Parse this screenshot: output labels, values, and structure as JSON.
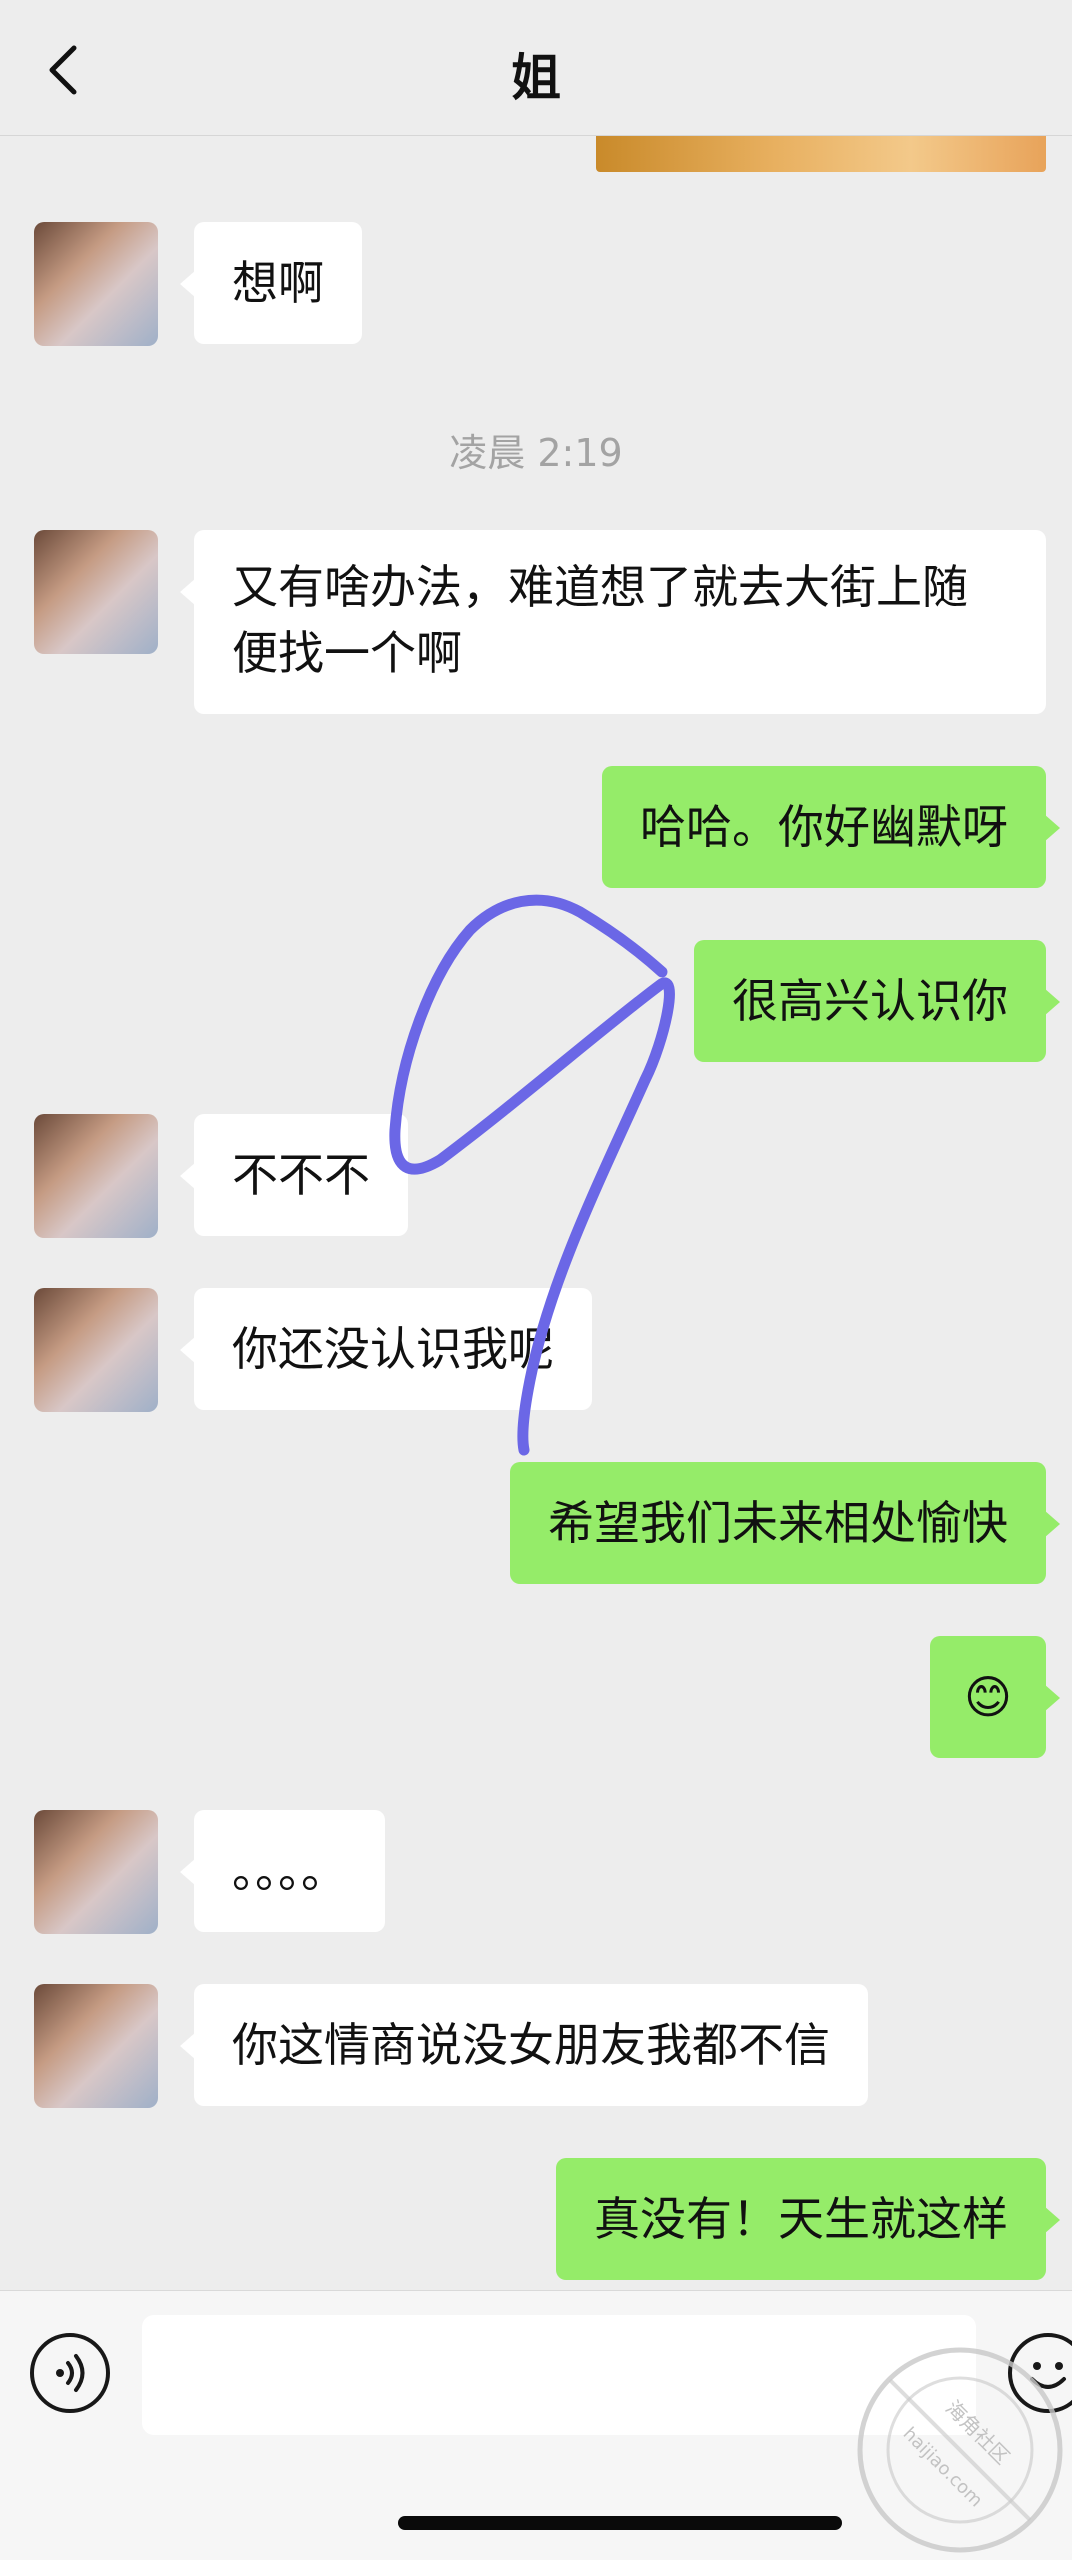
{
  "header": {
    "title": "姐"
  },
  "timestamp": "凌晨 2:19",
  "messages": [
    {
      "side": "left",
      "text": "想啊"
    },
    {
      "side": "left",
      "text": "又有啥办法，难道想了就去大街上随便找一个啊"
    },
    {
      "side": "right",
      "text": "哈哈。你好幽默呀"
    },
    {
      "side": "right",
      "text": "很高兴认识你"
    },
    {
      "side": "left",
      "text": "不不不"
    },
    {
      "side": "left",
      "text": "你还没认识我呢"
    },
    {
      "side": "right",
      "text": "希望我们未来相处愉快"
    },
    {
      "side": "right",
      "text": "😊"
    },
    {
      "side": "left",
      "text": "。。。。"
    },
    {
      "side": "left",
      "text": "你这情商说没女朋友我都不信"
    },
    {
      "side": "right",
      "text": "真没有！天生就这样"
    }
  ],
  "input": {
    "value": ""
  },
  "watermark": {
    "text_cn": "海角社区",
    "text_en": "haijiao.com"
  },
  "colors": {
    "sent_bubble": "#95ec69",
    "received_bubble": "#ffffff",
    "background": "#ededed",
    "scribble": "#6b67e6"
  },
  "icons": {
    "back": "chevron-left-icon",
    "voice": "voice-input-icon",
    "emoji": "emoji-icon"
  }
}
